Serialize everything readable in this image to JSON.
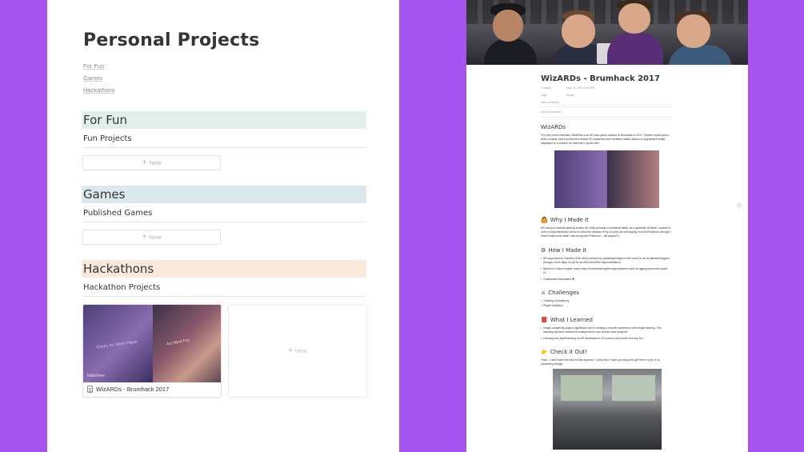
{
  "left": {
    "title": "Personal Projects",
    "toc": [
      "For Fun",
      "Games",
      "Hackathons"
    ],
    "sections": [
      {
        "heading": "For Fun",
        "subheading": "Fun Projects",
        "new_label": "New",
        "color": "#e0efea"
      },
      {
        "heading": "Games",
        "subheading": "Published Games",
        "new_label": "New",
        "color": "#dbe9ee"
      },
      {
        "heading": "Hackathons",
        "subheading": "Hackathon Projects",
        "new_label": "New",
        "color": "#fbeadb"
      }
    ],
    "card": {
      "title": "WizARDs - Brumhack 2017",
      "image_text_left": "Victory for Silent Prayer",
      "image_text_right": "Act Mind Fire",
      "image_logo": "TableView"
    },
    "new_card_label": "New"
  },
  "right": {
    "title": "WizARDs - Brumhack 2017",
    "props": [
      {
        "key": "Created",
        "value": "May 22, 2021 4:48 PM"
      },
      {
        "key": "Tags",
        "value": "Empty"
      }
    ],
    "add_property": "Add a property",
    "add_comment": "Add a comment...",
    "h_wizards": "WizARDs",
    "p_intro": "Fun very much intended, WizARds is an AR card game created at Brumhack in 2017. Players would print a deck of cards, which would then anchor 3D characters and clickable attack actions in augmented reality, displayed on a monitor for that real E-sports vibe.",
    "h_why": "Why I Made It",
    "icon_why": "🙆",
    "p_why": "AR was just recently starting to take off, while primarily in industrial fields, as a gamedev at heart I wanted to work a small interactive demo to relive the dreams of my 13 year old self playing YuGiOh/Pokémon (though I never really knew what I was doing with Pokémon... did anyone?)",
    "h_how": "How I Made It",
    "icon_how": "⚙",
    "how_items": [
      "AR supported by Vuforia's SDK which worked by uploading images to the cloud to act as labelled triggers. (though, these days I'd opt for an ARCore/ARKit implementation)",
      "Based on Unity's engine, super easy to implement game logic/systems such as rigging and world space UI.",
      "3 awesome teammates ❤"
    ],
    "h_challenges": "Challenges",
    "icon_challenges": "⚔",
    "challenge_items": [
      "Tracking Consistency",
      "Player Definition"
    ],
    "h_learned": "What I Learned",
    "icon_learned": "📕",
    "learned_items": [
      "Image complexity plays a significant role in creating a smooth experience with image tracking. This learning has been reinforced multiple times over across other projects!",
      "Learning and implementing an AR framework in 24 hours is very hectic but very fun"
    ],
    "h_check": "Check it Out!",
    "icon_check": "👉",
    "p_check": "Yeah... I don't have the repo to this anymore :( sorry! But I hope you enjoy the gif! Here's a pic of us presenting though:",
    "next_icon": "›"
  }
}
